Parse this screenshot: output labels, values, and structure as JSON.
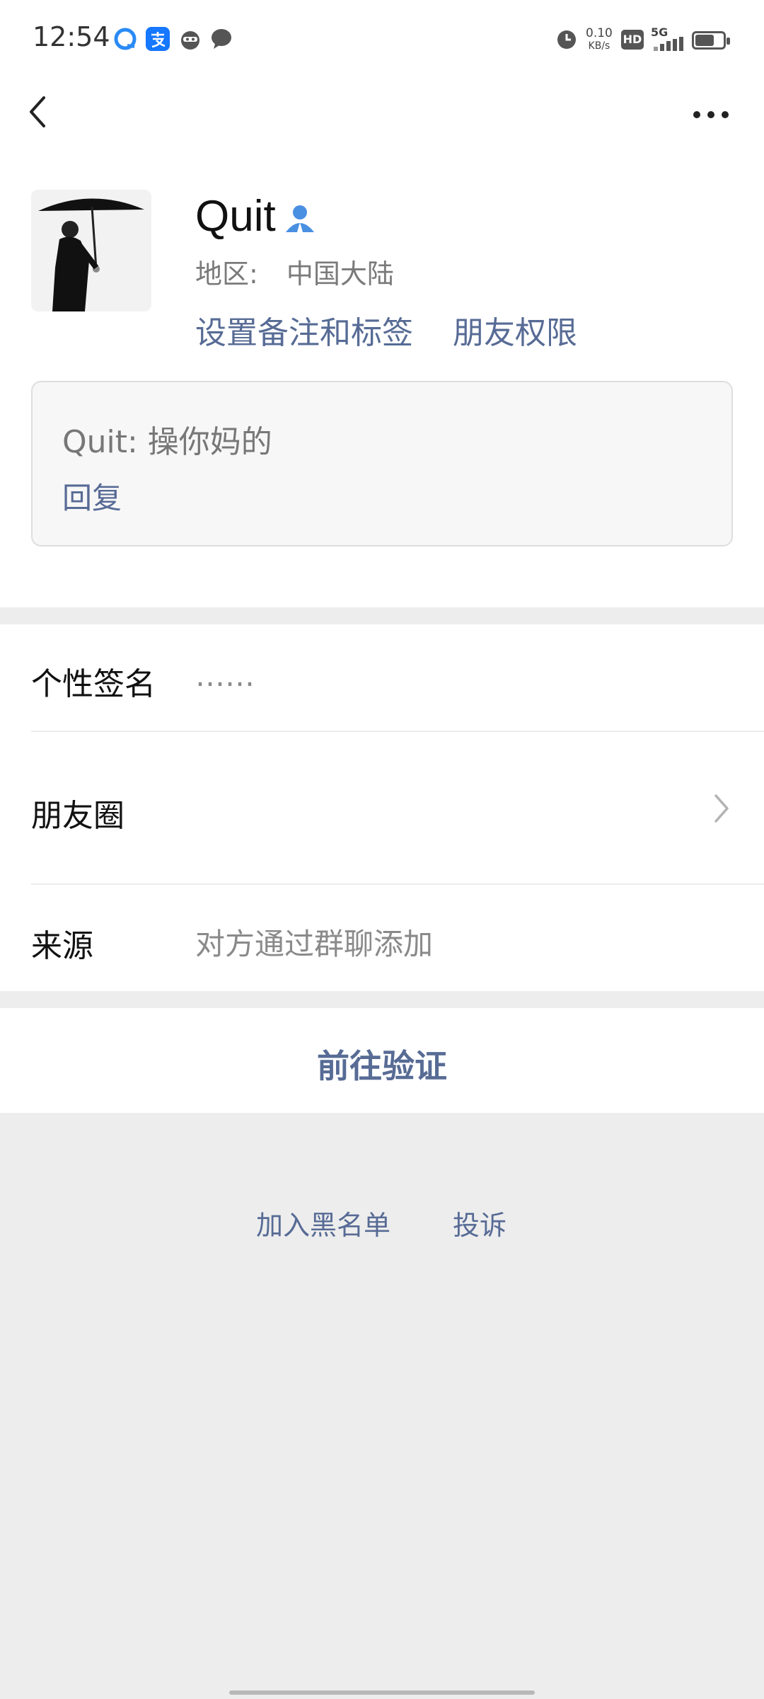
{
  "status": {
    "time": "12:54",
    "net_speed": "0.10",
    "net_unit": "KB/s",
    "hd": "HD",
    "signal": "5G"
  },
  "profile": {
    "name": "Quit",
    "region_label": "地区:",
    "region_value": "中国大陆",
    "set_remark": "设置备注和标签",
    "friend_perm": "朋友权限"
  },
  "message": {
    "text": "Quit:  操你妈的",
    "reply": "回复"
  },
  "rows": {
    "signature_label": "个性签名",
    "signature_value": "……",
    "moments_label": "朋友圈",
    "source_label": "来源",
    "source_value": "对方通过群聊添加"
  },
  "actions": {
    "verify": "前往验证",
    "blacklist": "加入黑名单",
    "complain": "投诉"
  },
  "colors": {
    "link": "#576b95",
    "background": "#ededed",
    "verify_badge": "#4a90e2"
  }
}
